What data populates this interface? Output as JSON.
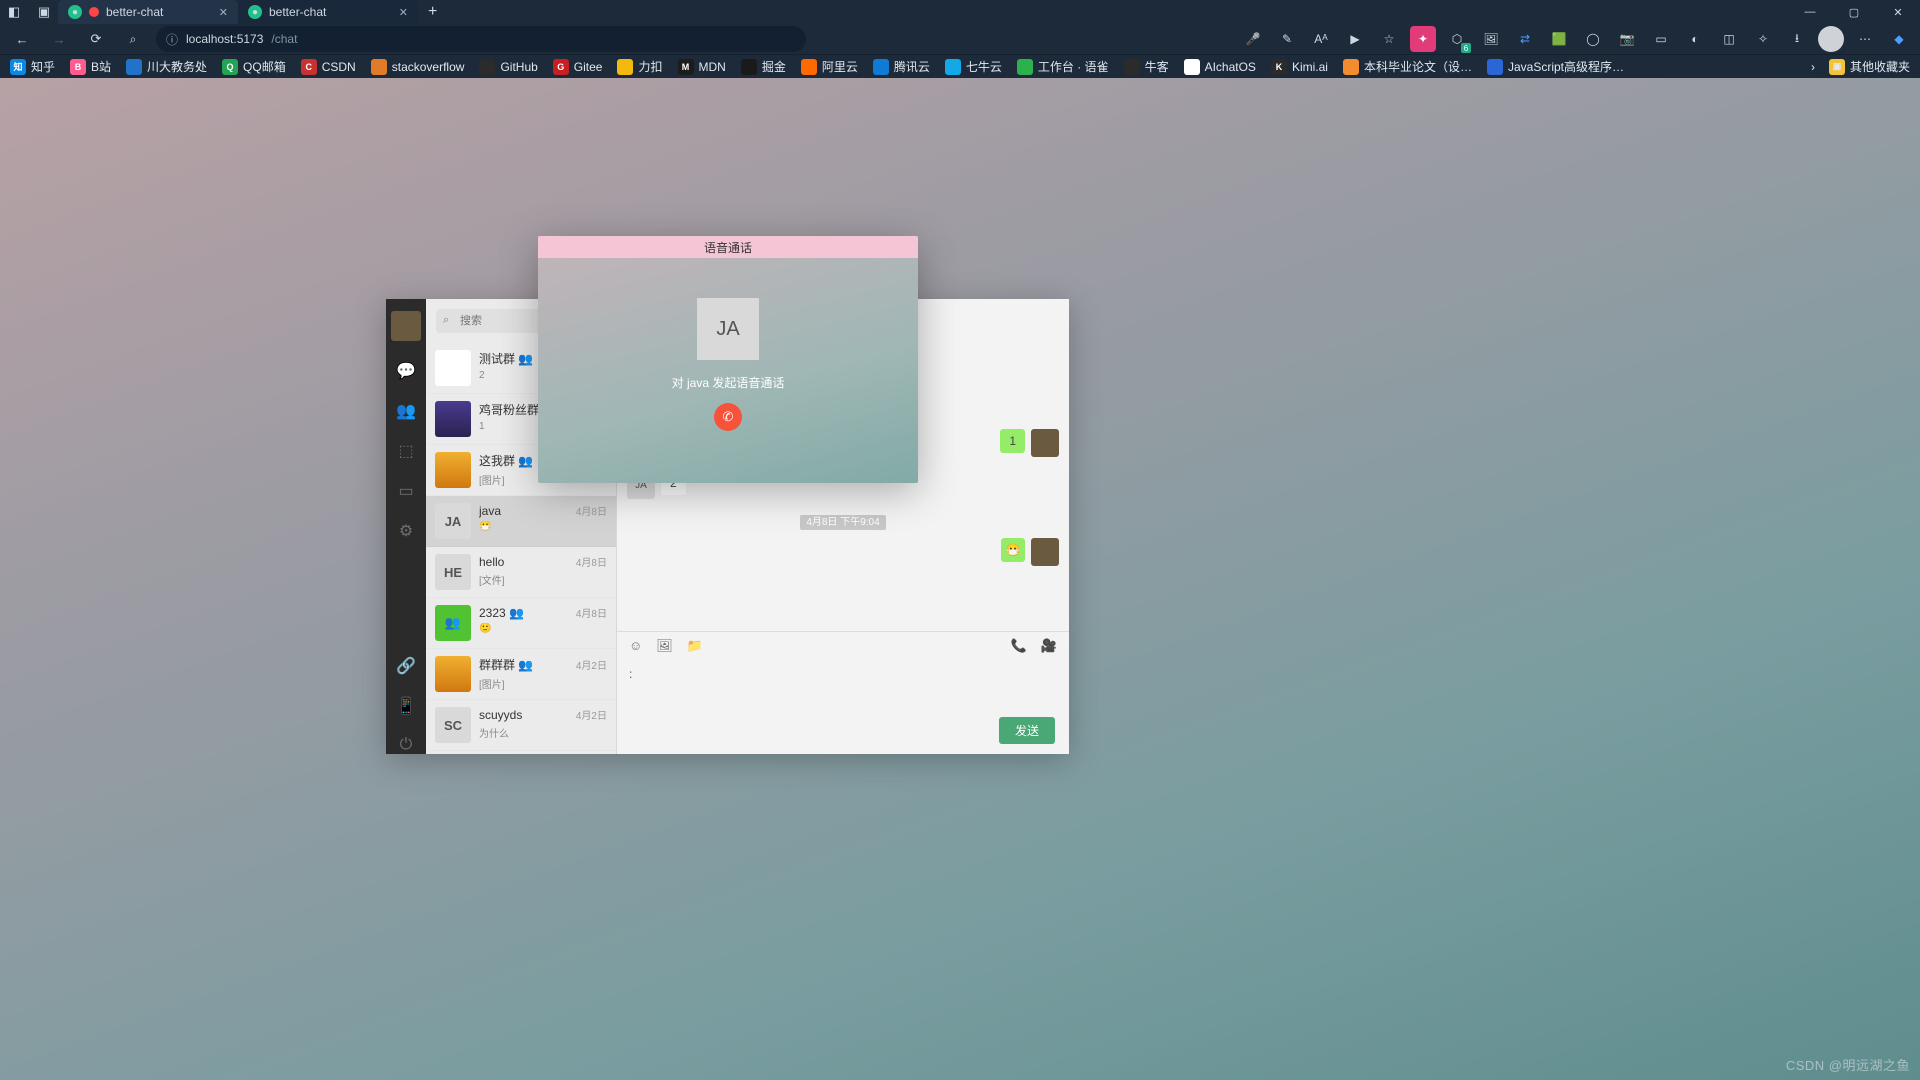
{
  "browser": {
    "tabs": [
      {
        "title": "better-chat",
        "fav_bg": "#ff4545"
      },
      {
        "title": "better-chat",
        "fav_bg": "#33cc99"
      }
    ],
    "url_host": "localhost:5173",
    "url_path": "/chat",
    "win": {
      "min": "—",
      "max": "▢",
      "close": "✕"
    }
  },
  "bookmarks": [
    {
      "icon_bg": "#0b87e6",
      "icon_txt": "知",
      "label": "知乎"
    },
    {
      "icon_bg": "#ff5c8d",
      "icon_txt": "B",
      "label": "B站"
    },
    {
      "icon_bg": "#2372c9",
      "icon_txt": "",
      "label": "川大教务处"
    },
    {
      "icon_bg": "#23a455",
      "icon_txt": "Q",
      "label": "QQ邮箱"
    },
    {
      "icon_bg": "#c83131",
      "icon_txt": "C",
      "label": "CSDN"
    },
    {
      "icon_bg": "#e07b2a",
      "icon_txt": "",
      "label": "stackoverflow"
    },
    {
      "icon_bg": "#2b2b2b",
      "icon_txt": "",
      "label": "GitHub"
    },
    {
      "icon_bg": "#c71d23",
      "icon_txt": "G",
      "label": "Gitee"
    },
    {
      "icon_bg": "#f2b90f",
      "icon_txt": "",
      "label": "力扣"
    },
    {
      "icon_bg": "#1c1c1c",
      "icon_txt": "M",
      "label": "MDN"
    },
    {
      "icon_bg": "#1a1a1a",
      "icon_txt": "",
      "label": "掘金"
    },
    {
      "icon_bg": "#ff6a00",
      "icon_txt": "",
      "label": "阿里云"
    },
    {
      "icon_bg": "#0f7bd6",
      "icon_txt": "",
      "label": "腾讯云"
    },
    {
      "icon_bg": "#13a9e6",
      "icon_txt": "",
      "label": "七牛云"
    },
    {
      "icon_bg": "#2bb24c",
      "icon_txt": "",
      "label": "工作台 · 语雀"
    },
    {
      "icon_bg": "#2b2b2b",
      "icon_txt": "",
      "label": "牛客"
    },
    {
      "icon_bg": "#ffffff",
      "icon_txt": "",
      "label": "AIchatOS"
    },
    {
      "icon_bg": "#2b2b2b",
      "icon_txt": "K",
      "label": "Kimi.ai"
    },
    {
      "icon_bg": "#f28c2e",
      "icon_txt": "",
      "label": "本科毕业论文（设…"
    },
    {
      "icon_bg": "#2a66d6",
      "icon_txt": "",
      "label": "JavaScript高级程序…"
    }
  ],
  "bookmarks_right": {
    "other": "其他收藏夹"
  },
  "sidebar_nav": [
    "chat-icon",
    "contacts-icon",
    "box-icon",
    "display-icon",
    "gear-icon"
  ],
  "sidebar_bottom": [
    "link-icon",
    "phone-icon",
    "power-icon"
  ],
  "search": {
    "placeholder": "搜索"
  },
  "chats": [
    {
      "avatar_class": "panda",
      "avatar_txt": "",
      "name": "测试群 👥",
      "date": "",
      "preview": "2"
    },
    {
      "avatar_class": "purple",
      "avatar_txt": "",
      "name": "鸡哥粉丝群 👥",
      "date": "",
      "preview": "1"
    },
    {
      "avatar_class": "orange",
      "avatar_txt": "",
      "name": "这我群 👥",
      "date": "",
      "preview": "[图片]"
    },
    {
      "avatar_class": "gray",
      "avatar_txt": "JA",
      "name": "java",
      "date": "4月8日",
      "preview": "😷",
      "active": true
    },
    {
      "avatar_class": "gray",
      "avatar_txt": "HE",
      "name": "hello",
      "date": "4月8日",
      "preview": "[文件]"
    },
    {
      "avatar_class": "green",
      "avatar_txt": "👥",
      "name": "2323 👥",
      "date": "4月8日",
      "preview": "🙂"
    },
    {
      "avatar_class": "orange",
      "avatar_txt": "",
      "name": "群群群 👥",
      "date": "4月2日",
      "preview": "[图片]"
    },
    {
      "avatar_class": "gray",
      "avatar_txt": "SC",
      "name": "scuyyds",
      "date": "4月2日",
      "preview": "为什么"
    }
  ],
  "messages": {
    "m1": {
      "text": "1"
    },
    "m2_sender": "JA",
    "m2": {
      "text": "2"
    },
    "ts": "4月8日 下午9:04"
  },
  "input": {
    "text": ":",
    "send": "发送"
  },
  "call": {
    "title": "语音通话",
    "avatar": "JA",
    "text": "对 java 发起语音通话"
  },
  "watermark": "CSDN @明远湖之鱼"
}
